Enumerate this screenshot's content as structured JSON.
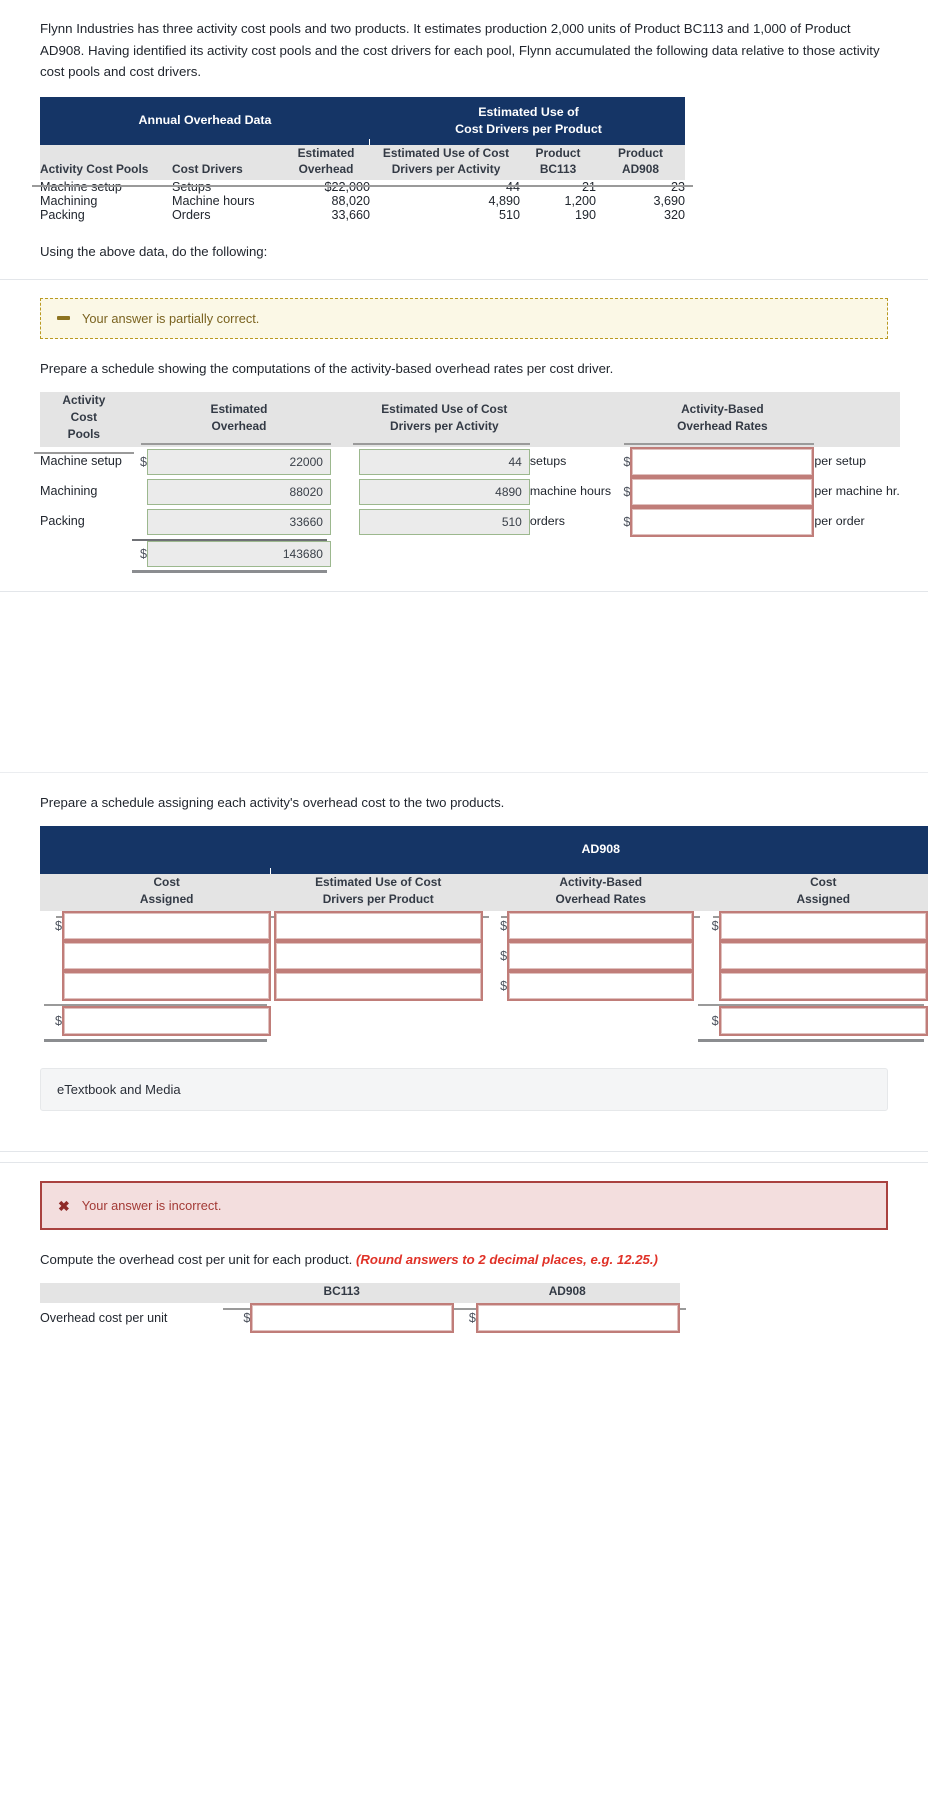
{
  "intro": {
    "paragraph": "Flynn Industries has three activity cost pools and two products. It estimates production 2,000 units of Product BC113 and 1,000 of Product AD908. Having identified its activity cost pools and the cost drivers for each pool, Flynn accumulated the following data relative to those activity cost pools and cost drivers."
  },
  "colors": {
    "header_blue": "#153566",
    "header_grey": "#e4e4e4",
    "correct_green_border": "#9cb88e",
    "incorrect_red_border": "#c07d79",
    "warning_bg": "#fbf8e6",
    "error_bg": "#f3dede",
    "round_note_red": "#e03127"
  },
  "data_table": {
    "band_left": "Annual Overhead Data",
    "band_right_line1": "Estimated Use of",
    "band_right_line2": "Cost Drivers per Product",
    "headers": [
      {
        "line1": "",
        "line2": "Activity Cost Pools",
        "align": "l"
      },
      {
        "line1": "",
        "line2": "Cost Drivers",
        "align": "l"
      },
      {
        "line1": "Estimated",
        "line2": "Overhead",
        "align": "c"
      },
      {
        "line1": "Estimated Use of Cost",
        "line2": "Drivers per Activity",
        "align": "c"
      },
      {
        "line1": "Product",
        "line2": "BC113",
        "align": "c"
      },
      {
        "line1": "Product",
        "line2": "AD908",
        "align": "c"
      }
    ],
    "rows": [
      {
        "pool": "Machine setup",
        "driver": "Setups",
        "overhead": "$22,000",
        "use_per_activity": "44",
        "bc113": "21",
        "ad908": "23"
      },
      {
        "pool": "Machining",
        "driver": "Machine hours",
        "overhead": "88,020",
        "use_per_activity": "4,890",
        "bc113": "1,200",
        "ad908": "3,690"
      },
      {
        "pool": "Packing",
        "driver": "Orders",
        "overhead": "33,660",
        "use_per_activity": "510",
        "bc113": "190",
        "ad908": "320"
      }
    ]
  },
  "using_line": "Using the above data, do the following:",
  "banners": {
    "partial": {
      "icon": "dash-icon",
      "text": "Your answer is partially correct."
    },
    "incorrect": {
      "icon": "x-icon",
      "text": "Your answer is incorrect."
    }
  },
  "part_a": {
    "prompt": "Prepare a schedule showing the computations of the activity-based overhead rates per cost driver.",
    "headers": {
      "pools": [
        "Activity",
        "Cost",
        "Pools"
      ],
      "estimated_overhead": [
        "Estimated",
        "Overhead"
      ],
      "use_per_activity": [
        "Estimated Use of Cost",
        "Drivers per Activity"
      ],
      "rates": [
        "Activity-Based",
        "Overhead Rates"
      ]
    },
    "rows": [
      {
        "label": "Machine setup",
        "overhead_prefix": "$",
        "overhead_value": "22000",
        "overhead_state": "correct",
        "drivers_value": "44",
        "drivers_state": "correct",
        "unit": "setups",
        "rate_prefix": "$",
        "rate_value": "",
        "rate_state": "incorrect",
        "rate_suffix": "per setup"
      },
      {
        "label": "Machining",
        "overhead_prefix": "",
        "overhead_value": "88020",
        "overhead_state": "correct",
        "drivers_value": "4890",
        "drivers_state": "correct",
        "unit": "machine hours",
        "rate_prefix": "$",
        "rate_value": "",
        "rate_state": "incorrect",
        "rate_suffix": "per machine hr."
      },
      {
        "label": "Packing",
        "overhead_prefix": "",
        "overhead_value": "33660",
        "overhead_state": "correct",
        "drivers_value": "510",
        "drivers_state": "correct",
        "unit": "orders",
        "rate_prefix": "$",
        "rate_value": "",
        "rate_state": "incorrect",
        "rate_suffix": "per order"
      }
    ],
    "total": {
      "prefix": "$",
      "value": "143680",
      "state": "correct"
    }
  },
  "part_b": {
    "prompt": "Prepare a schedule assigning each activity's overhead cost to the two products.",
    "band_label": "AD908",
    "headers": [
      {
        "line1": "Cost",
        "line2": "Assigned"
      },
      {
        "line1": "Estimated Use of Cost",
        "line2": "Drivers per Product"
      },
      {
        "line1": "Activity-Based",
        "line2": "Overhead Rates"
      },
      {
        "line1": "Cost",
        "line2": "Assigned"
      }
    ],
    "rows": [
      {
        "c1_prefix": "$",
        "c1_value": "",
        "c1_state": "incorrect",
        "c2_prefix": "",
        "c2_value": "",
        "c2_state": "incorrect",
        "c3_prefix": "$",
        "c3_value": "",
        "c3_state": "incorrect",
        "c4_prefix": "$",
        "c4_value": "",
        "c4_state": "incorrect"
      },
      {
        "c1_prefix": "",
        "c1_value": "",
        "c1_state": "incorrect",
        "c2_prefix": "",
        "c2_value": "",
        "c2_state": "incorrect",
        "c3_prefix": "$",
        "c3_value": "",
        "c3_state": "incorrect",
        "c4_prefix": "",
        "c4_value": "",
        "c4_state": "incorrect"
      },
      {
        "c1_prefix": "",
        "c1_value": "",
        "c1_state": "incorrect",
        "c2_prefix": "",
        "c2_value": "",
        "c2_state": "incorrect",
        "c3_prefix": "$",
        "c3_value": "",
        "c3_state": "incorrect",
        "c4_prefix": "",
        "c4_value": "",
        "c4_state": "incorrect"
      }
    ],
    "total": {
      "c1_prefix": "$",
      "c1_value": "",
      "c1_state": "incorrect",
      "c4_prefix": "$",
      "c4_value": "",
      "c4_state": "incorrect"
    }
  },
  "etextbook": {
    "label": "eTextbook and Media"
  },
  "part_c": {
    "prompt_main": "Compute the overhead cost per unit for each product.",
    "prompt_note": "(Round answers to 2 decimal places, e.g. 12.25.)",
    "headers": [
      "",
      "BC113",
      "AD908"
    ],
    "row": {
      "label": "Overhead cost per unit",
      "bc113_prefix": "$",
      "bc113_value": "",
      "bc113_state": "incorrect",
      "ad908_prefix": "$",
      "ad908_value": "",
      "ad908_state": "incorrect"
    }
  }
}
